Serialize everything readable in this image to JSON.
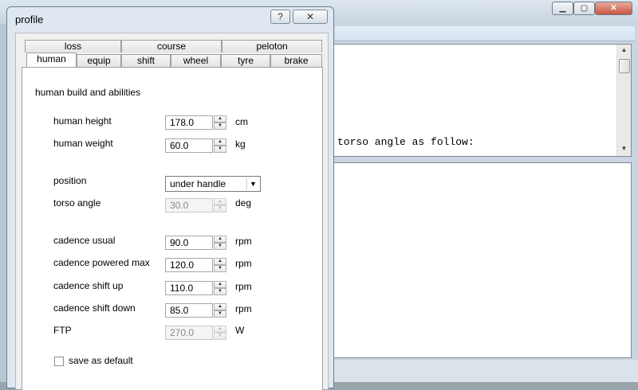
{
  "main_window": {
    "console_text": "torso angle as follow:",
    "min_label": "▁",
    "max_label": "▢",
    "close_label": "✕"
  },
  "dialog": {
    "title": "profile",
    "help_label": "?",
    "close_label": "✕",
    "tabs_row1": [
      "loss",
      "course",
      "peloton"
    ],
    "tabs_row2": [
      "human",
      "equip",
      "shift",
      "wheel",
      "tyre",
      "brake"
    ],
    "selected_tab": "human",
    "section_title": "human build and abilities",
    "fields": {
      "height": {
        "label": "human height",
        "value": "178.0",
        "unit": "cm"
      },
      "weight": {
        "label": "human weight",
        "value": "60.0",
        "unit": "kg"
      },
      "position": {
        "label": "position",
        "value": "under handle"
      },
      "torso": {
        "label": "torso angle",
        "value": "30.0",
        "unit": "deg"
      },
      "cad_usual": {
        "label": "cadence usual",
        "value": "90.0",
        "unit": "rpm"
      },
      "cad_max": {
        "label": "cadence powered max",
        "value": "120.0",
        "unit": "rpm"
      },
      "cad_up": {
        "label": "cadence shift up",
        "value": "110.0",
        "unit": "rpm"
      },
      "cad_down": {
        "label": "cadence shift down",
        "value": "85.0",
        "unit": "rpm"
      },
      "ftp": {
        "label": "FTP",
        "value": "270.0",
        "unit": "W"
      }
    },
    "save_default_label": "save as default",
    "save_default_checked": false
  }
}
